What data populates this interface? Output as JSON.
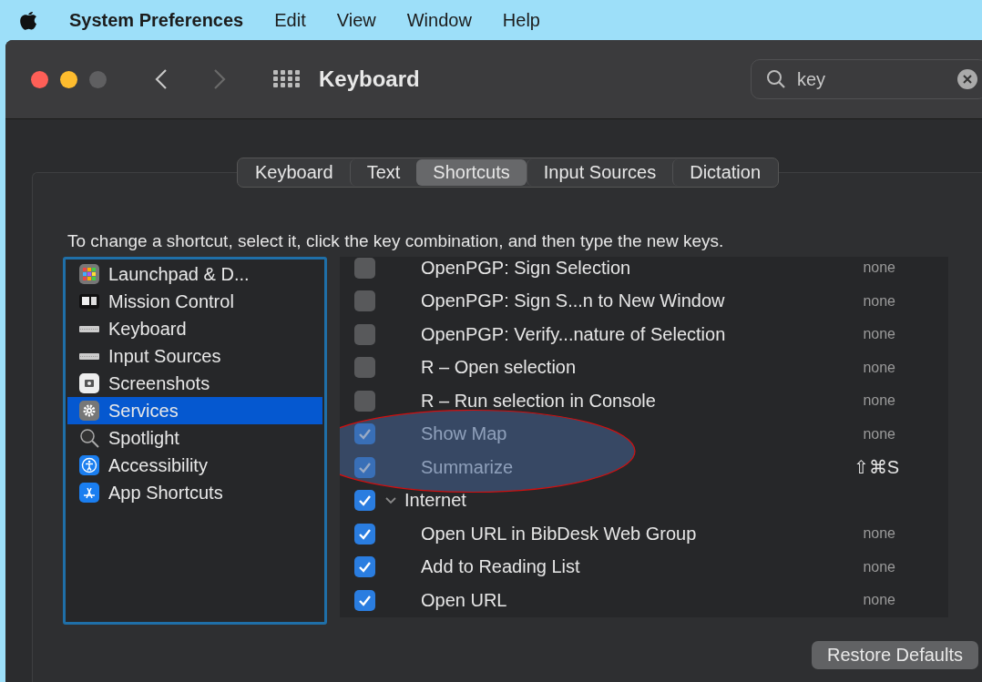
{
  "menu_bar": {
    "app": "System Preferences",
    "items": [
      "Edit",
      "View",
      "Window",
      "Help"
    ]
  },
  "window": {
    "title": "Keyboard",
    "search": {
      "value": "key"
    }
  },
  "tabs": [
    {
      "label": "Keyboard",
      "selected": false
    },
    {
      "label": "Text",
      "selected": false
    },
    {
      "label": "Shortcuts",
      "selected": true
    },
    {
      "label": "Input Sources",
      "selected": false
    },
    {
      "label": "Dictation",
      "selected": false
    }
  ],
  "instruction": "To change a shortcut, select it, click the key combination, and then type the new keys.",
  "sidebar": {
    "items": [
      {
        "label": "Launchpad & D...",
        "selected": false
      },
      {
        "label": "Mission Control",
        "selected": false
      },
      {
        "label": "Keyboard",
        "selected": false
      },
      {
        "label": "Input Sources",
        "selected": false
      },
      {
        "label": "Screenshots",
        "selected": false
      },
      {
        "label": "Services",
        "selected": true
      },
      {
        "label": "Spotlight",
        "selected": false
      },
      {
        "label": "Accessibility",
        "selected": false
      },
      {
        "label": "App Shortcuts",
        "selected": false
      }
    ]
  },
  "shortcuts": [
    {
      "kind": "item",
      "label": "OpenPGP: Sign Selection",
      "shortcut": "none",
      "checked": false,
      "highlighted": false
    },
    {
      "kind": "item",
      "label": "OpenPGP: Sign S...n to New Window",
      "shortcut": "none",
      "checked": false,
      "highlighted": false
    },
    {
      "kind": "item",
      "label": "OpenPGP: Verify...nature of Selection",
      "shortcut": "none",
      "checked": false,
      "highlighted": false
    },
    {
      "kind": "item",
      "label": "R – Open selection",
      "shortcut": "none",
      "checked": false,
      "highlighted": false
    },
    {
      "kind": "item",
      "label": "R – Run selection in Console",
      "shortcut": "none",
      "checked": false,
      "highlighted": false
    },
    {
      "kind": "item",
      "label": "Show Map",
      "shortcut": "none",
      "checked": true,
      "highlighted": true
    },
    {
      "kind": "item",
      "label": "Summarize",
      "shortcut": "⇧⌘S",
      "checked": true,
      "highlighted": true
    },
    {
      "kind": "group",
      "label": "Internet",
      "checked": true,
      "expanded": true,
      "highlighted": false
    },
    {
      "kind": "item",
      "label": "Open URL in BibDesk Web Group",
      "shortcut": "none",
      "checked": true,
      "highlighted": false
    },
    {
      "kind": "item",
      "label": "Add to Reading List",
      "shortcut": "none",
      "checked": true,
      "highlighted": false
    },
    {
      "kind": "item",
      "label": "Open URL",
      "shortcut": "none",
      "checked": true,
      "highlighted": false
    }
  ],
  "restore_button": "Restore Defaults"
}
